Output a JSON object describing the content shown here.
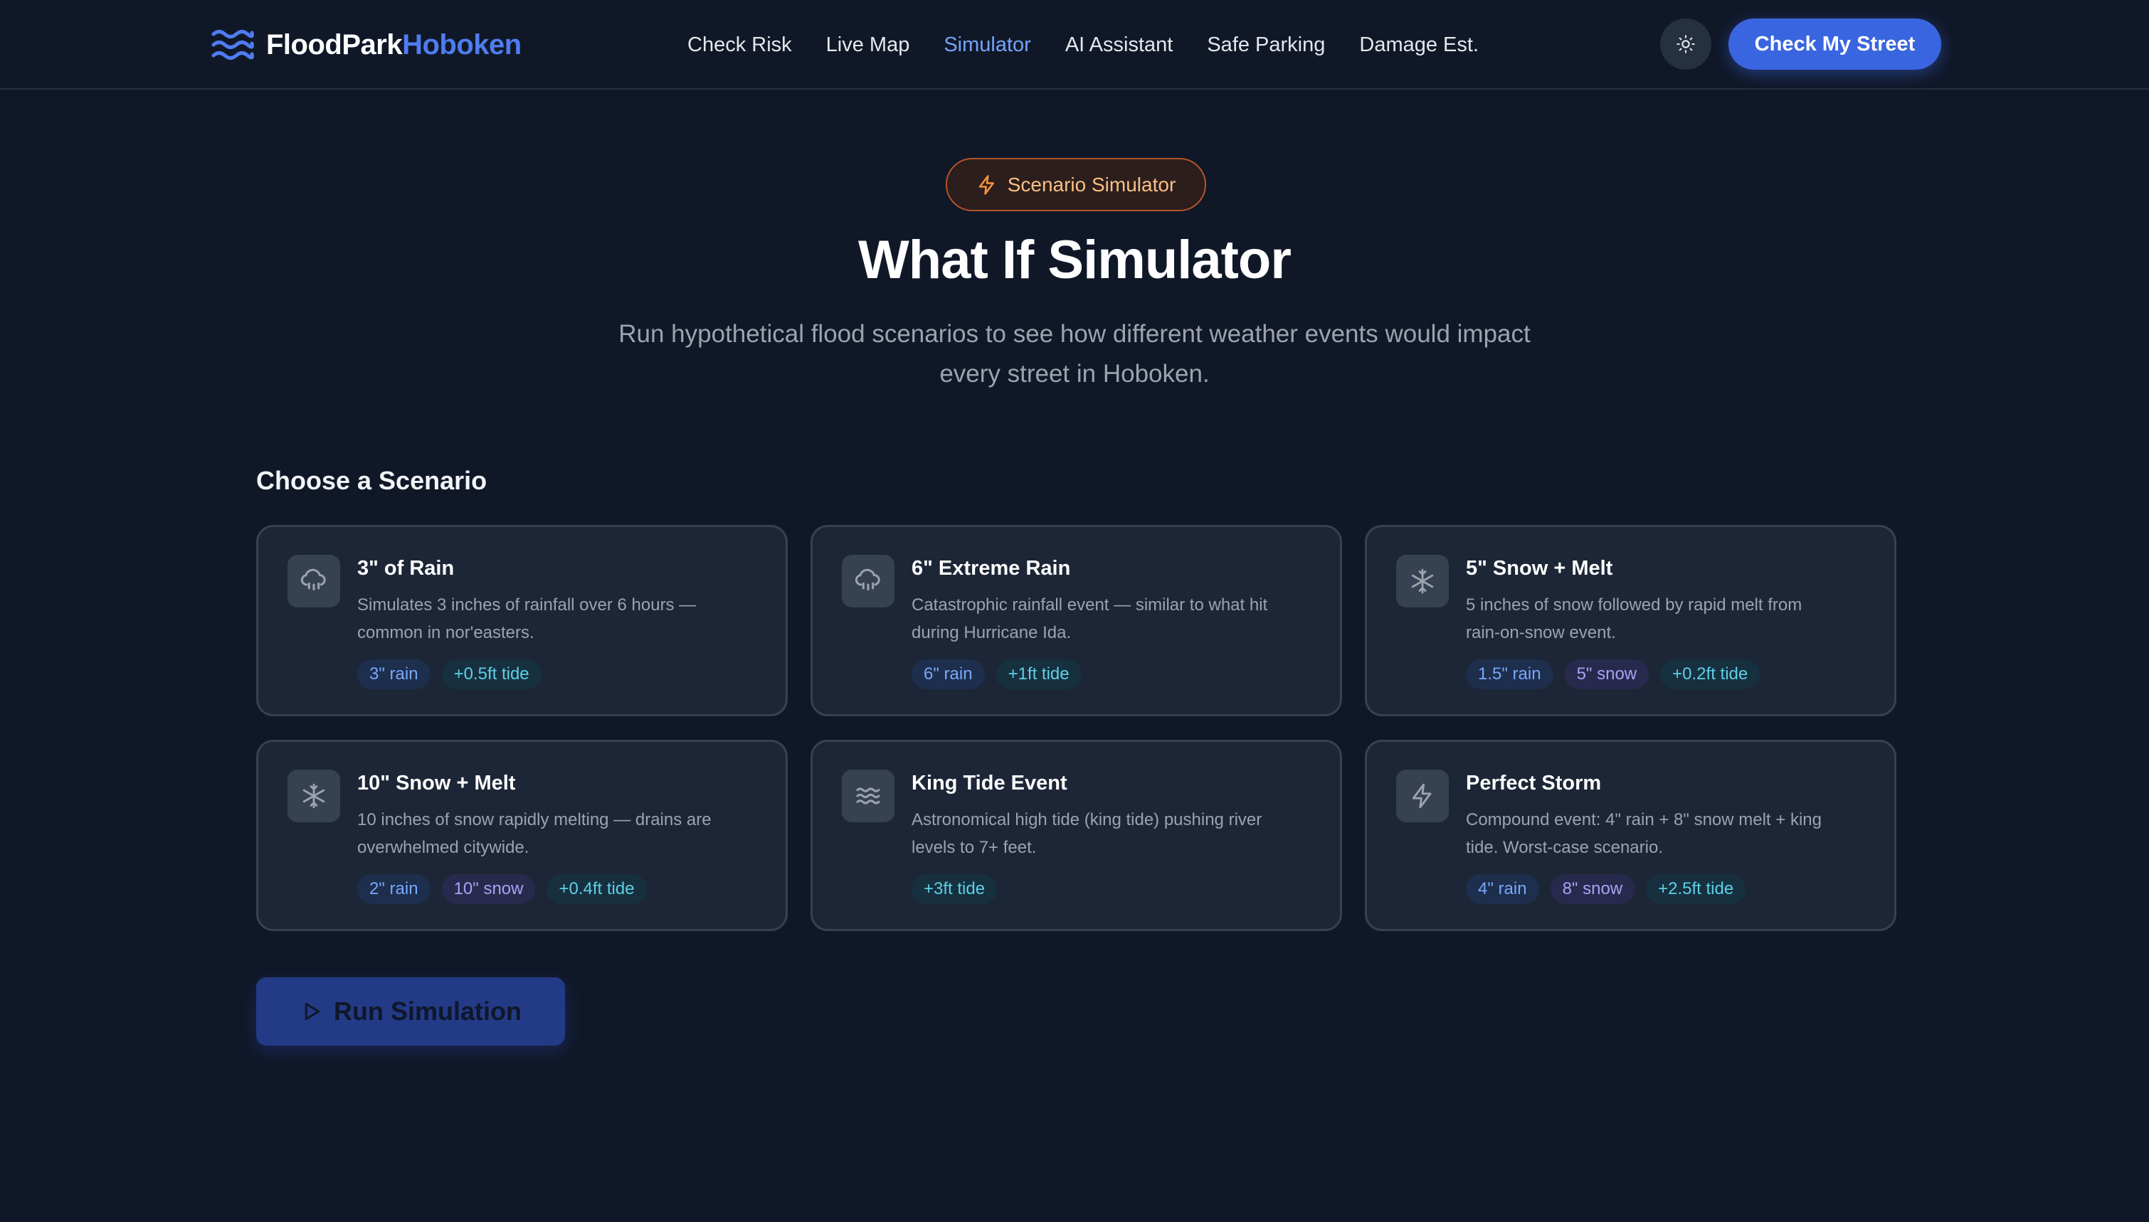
{
  "brand": {
    "name_part1": "FloodPark",
    "name_part2": "Hoboken",
    "logo_icon": "waves-icon"
  },
  "nav": {
    "links": [
      {
        "label": "Check Risk",
        "active": false
      },
      {
        "label": "Live Map",
        "active": false
      },
      {
        "label": "Simulator",
        "active": true
      },
      {
        "label": "AI Assistant",
        "active": false
      },
      {
        "label": "Safe Parking",
        "active": false
      },
      {
        "label": "Damage Est.",
        "active": false
      }
    ],
    "theme_icon": "sun-icon",
    "cta_label": "Check My Street"
  },
  "hero": {
    "badge_icon": "lightning-icon",
    "badge_label": "Scenario Simulator",
    "title": "What If Simulator",
    "subtitle_line1": "Run hypothetical flood scenarios to see how different weather events would impact",
    "subtitle_line2": "every street in Hoboken."
  },
  "scenarios": {
    "heading": "Choose a Scenario",
    "items": [
      {
        "icon": "cloud-rain-icon",
        "title": "3\" of Rain",
        "desc_line1": "Simulates 3 inches of rainfall over 6 hours —",
        "desc_line2": "common in nor'easters.",
        "tags": [
          {
            "label": "3\" rain",
            "kind": "rain"
          },
          {
            "label": "+0.5ft tide",
            "kind": "tide"
          }
        ]
      },
      {
        "icon": "cloud-rain-icon",
        "title": "6\" Extreme Rain",
        "desc_line1": "Catastrophic rainfall event — similar to what hit",
        "desc_line2": "during Hurricane Ida.",
        "tags": [
          {
            "label": "6\" rain",
            "kind": "rain"
          },
          {
            "label": "+1ft tide",
            "kind": "tide"
          }
        ]
      },
      {
        "icon": "snowflake-icon",
        "title": "5\" Snow + Melt",
        "desc_line1": "5 inches of snow followed by rapid melt from",
        "desc_line2": "rain-on-snow event.",
        "tags": [
          {
            "label": "1.5\" rain",
            "kind": "rain"
          },
          {
            "label": "5\" snow",
            "kind": "snow"
          },
          {
            "label": "+0.2ft tide",
            "kind": "tide"
          }
        ]
      },
      {
        "icon": "snowflake-icon",
        "title": "10\" Snow + Melt",
        "desc_line1": "10 inches of snow rapidly melting — drains are",
        "desc_line2": "overwhelmed citywide.",
        "tags": [
          {
            "label": "2\" rain",
            "kind": "rain"
          },
          {
            "label": "10\" snow",
            "kind": "snow"
          },
          {
            "label": "+0.4ft tide",
            "kind": "tide"
          }
        ]
      },
      {
        "icon": "waves-icon",
        "title": "King Tide Event",
        "desc_line1": "Astronomical high tide (king tide) pushing river",
        "desc_line2": "levels to 7+ feet.",
        "tags": [
          {
            "label": "+3ft tide",
            "kind": "tide"
          }
        ]
      },
      {
        "icon": "lightning-icon",
        "title": "Perfect Storm",
        "desc_line1": "Compound event: 4\" rain + 8\" snow melt + king",
        "desc_line2": "tide. Worst-case scenario.",
        "tags": [
          {
            "label": "4\" rain",
            "kind": "rain"
          },
          {
            "label": "8\" snow",
            "kind": "snow"
          },
          {
            "label": "+2.5ft tide",
            "kind": "tide"
          }
        ]
      }
    ]
  },
  "run_button": {
    "icon": "play-icon",
    "label": "Run Simulation"
  },
  "colors": {
    "background": "#101828",
    "accent": "#3a65e0",
    "active_nav": "#74a3fb",
    "badge": "#fbbf85"
  }
}
